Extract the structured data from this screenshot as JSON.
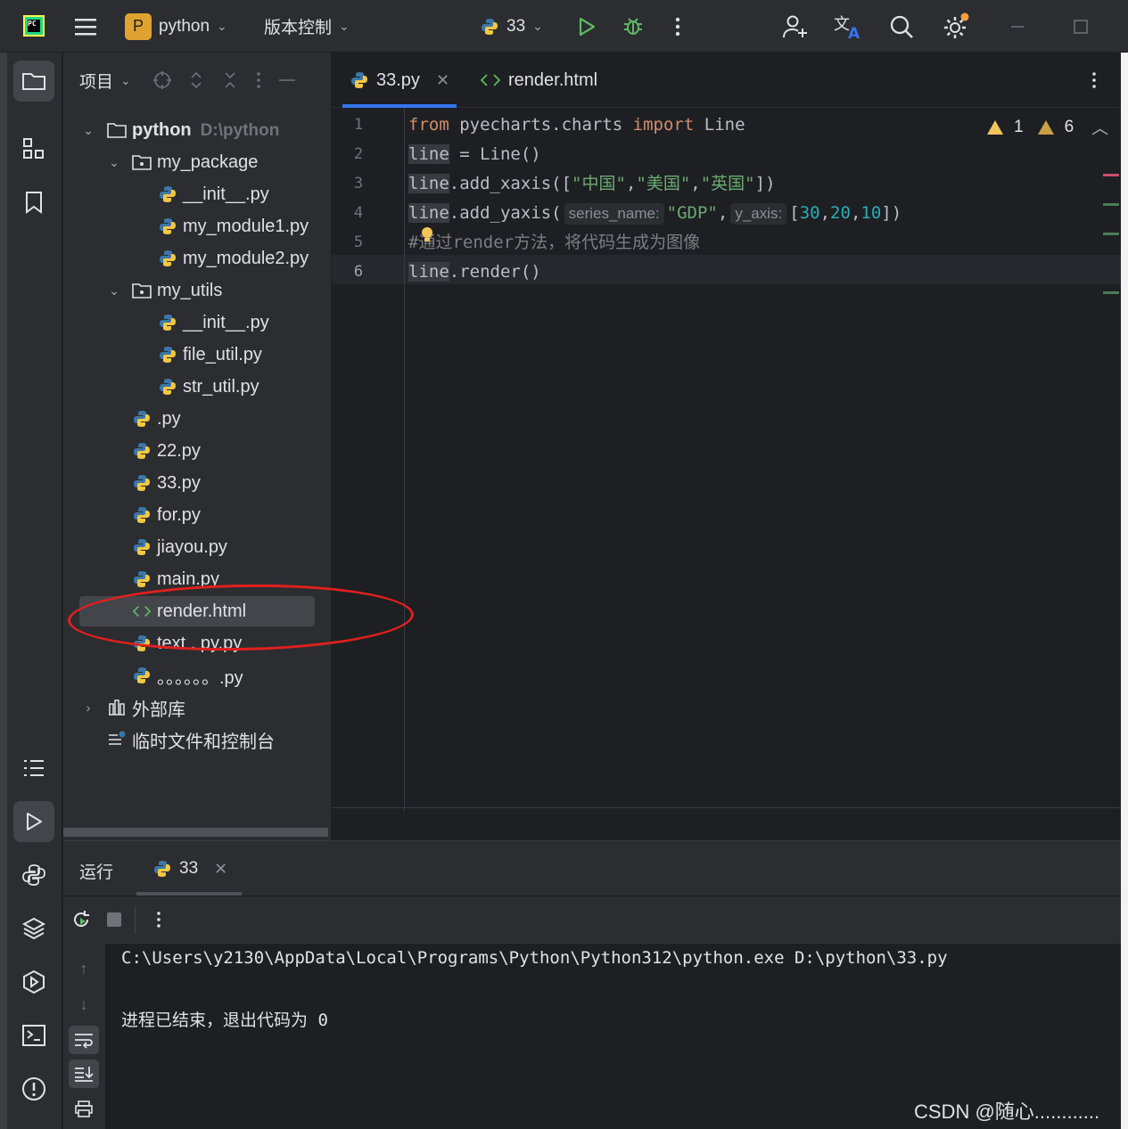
{
  "titlebar": {
    "logo_text": "PC",
    "project_badge": "P",
    "project_name": "python",
    "vcs_label": "版本控制",
    "run_config": "33"
  },
  "project_panel": {
    "title": "项目",
    "tree": [
      {
        "label": "python",
        "hint": "D:\\python",
        "type": "folder",
        "level": 0,
        "expanded": true
      },
      {
        "label": "my_package",
        "type": "package",
        "level": 1,
        "expanded": true
      },
      {
        "label": "__init__.py",
        "type": "py",
        "level": 2
      },
      {
        "label": "my_module1.py",
        "type": "py",
        "level": 2
      },
      {
        "label": "my_module2.py",
        "type": "py",
        "level": 2
      },
      {
        "label": "my_utils",
        "type": "package",
        "level": 1,
        "expanded": true
      },
      {
        "label": "__init__.py",
        "type": "py",
        "level": 2
      },
      {
        "label": "file_util.py",
        "type": "py",
        "level": 2
      },
      {
        "label": "str_util.py",
        "type": "py",
        "level": 2
      },
      {
        "label": ".py",
        "type": "py",
        "level": 1
      },
      {
        "label": "22.py",
        "type": "py",
        "level": 1
      },
      {
        "label": "33.py",
        "type": "py",
        "level": 1
      },
      {
        "label": "for.py",
        "type": "py",
        "level": 1
      },
      {
        "label": "jiayou.py",
        "type": "py",
        "level": 1
      },
      {
        "label": "main.py",
        "type": "py",
        "level": 1
      },
      {
        "label": "render.html",
        "type": "html",
        "level": 1,
        "selected": true
      },
      {
        "label": "text . py.py",
        "type": "py",
        "level": 1
      },
      {
        "label": "。。。。。。.py",
        "type": "py",
        "level": 1
      },
      {
        "label": "外部库",
        "type": "lib",
        "level": 0
      },
      {
        "label": "临时文件和控制台",
        "type": "scratch",
        "level": 0
      }
    ]
  },
  "editor": {
    "tabs": [
      {
        "label": "33.py",
        "active": true
      },
      {
        "label": "render.html",
        "active": false
      }
    ],
    "inspections": {
      "warnings": "1",
      "weak_warnings": "6"
    },
    "line_numbers": [
      "1",
      "2",
      "3",
      "4",
      "5",
      "6"
    ],
    "code": {
      "l1_kw1": "from",
      "l1_mod": " pyecharts.charts ",
      "l1_kw2": "import",
      "l1_name": " Line",
      "l2_var": "line",
      "l2_rest": " = Line()",
      "l3_var": "line",
      "l3_call": ".add_xaxis([",
      "l3_s1": "\"中国\"",
      "l3_c1": ",",
      "l3_s2": "\"美国\"",
      "l3_c2": ",",
      "l3_s3": "\"英国\"",
      "l3_end": "])",
      "l4_var": "line",
      "l4_call": ".add_yaxis(",
      "l4_hint1": "series_name:",
      "l4_s1": "\"GDP\"",
      "l4_c1": ",",
      "l4_hint2": "y_axis:",
      "l4_open": "[",
      "l4_n1": "30",
      "l4_n2": "20",
      "l4_n3": "10",
      "l4_comma": ",",
      "l4_end": "])",
      "l5_cmt": "#通过render方法，将代码生成为图像",
      "l6_var": "line",
      "l6_rest": ".render()"
    }
  },
  "run_panel": {
    "title": "运行",
    "tab_label": "33",
    "console": [
      "C:\\Users\\y2130\\AppData\\Local\\Programs\\Python\\Python312\\python.exe D:\\python\\33.py",
      "进程已结束，退出代码为 0"
    ]
  },
  "watermark": "CSDN @随心............",
  "colors": {
    "background": "#1e1f22",
    "panel": "#2b2d30",
    "accent": "#3574f0",
    "keyword": "#cf8e6d",
    "string": "#6aab73",
    "number": "#2aacb8",
    "annotation_circle": "#e0201e"
  }
}
